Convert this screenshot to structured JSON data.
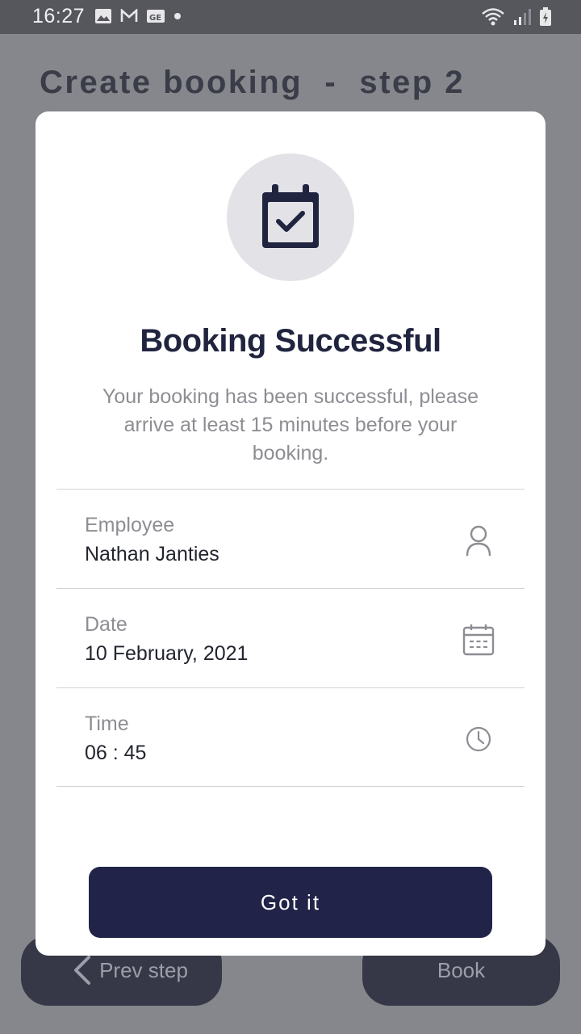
{
  "status_bar": {
    "time": "16:27",
    "icons_left": [
      "image-icon",
      "gmail-icon",
      "news-icon",
      "dot-icon"
    ],
    "icons_right": [
      "wifi-icon",
      "signal-icon",
      "battery-icon"
    ]
  },
  "page": {
    "title": "Create booking  -  step 2",
    "prev_label": "Prev step",
    "book_label": "Book"
  },
  "modal": {
    "icon": "calendar-check-icon",
    "title": "Booking Successful",
    "message": "Your booking has been successful, please arrive at least 15 minutes before your booking.",
    "details": [
      {
        "label": "Employee",
        "value": "Nathan Janties",
        "icon": "person-icon"
      },
      {
        "label": "Date",
        "value": "10 February, 2021",
        "icon": "calendar-icon"
      },
      {
        "label": "Time",
        "value": "06 : 45",
        "icon": "clock-icon"
      }
    ],
    "button_label": "Got it"
  },
  "colors": {
    "overlay_bg": "#85878d",
    "status_bar": "#55575d",
    "accent": "#212448",
    "muted_text": "#8d8d93"
  }
}
